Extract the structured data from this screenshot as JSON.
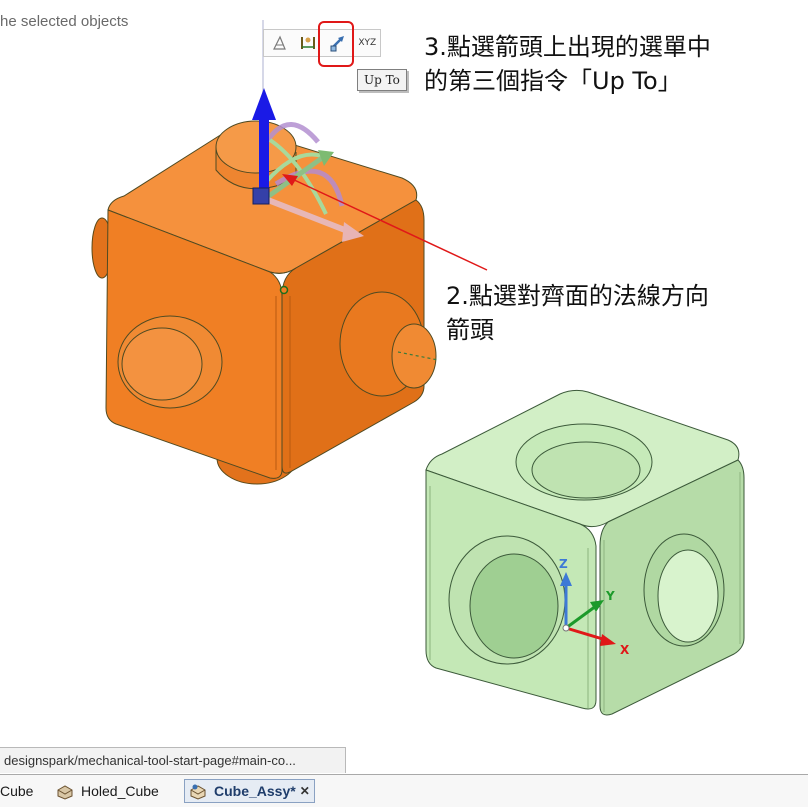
{
  "viewport": {
    "hint_text": "he selected objects"
  },
  "mini_toolbar": {
    "items": [
      {
        "name": "pull-option-icon",
        "label": ""
      },
      {
        "name": "ruler-dimension-icon",
        "label": ""
      },
      {
        "name": "up-to-icon",
        "label": ""
      },
      {
        "name": "xyz-icon",
        "label": "XYZ"
      }
    ],
    "tooltip": "Up To"
  },
  "annotations": {
    "step3": "3.點選箭頭上出現的選單中\n的第三個指令「Up To」",
    "step2": "2.點選對齊面的法線方向\n箭頭"
  },
  "axes": {
    "x": "X",
    "y": "Y",
    "z": "Z"
  },
  "colors": {
    "orange_part": "#f07f24",
    "green_part": "#c6eab9",
    "annotation_red": "#e01818",
    "arrow_blue": "#1a1ae6"
  },
  "status_bar": {
    "url": "designspark/mechanical-tool-start-page#main-co..."
  },
  "tabs": [
    {
      "label": "Cube",
      "active": false
    },
    {
      "label": "Holed_Cube",
      "active": false
    },
    {
      "label": "Cube_Assy*",
      "active": true
    }
  ]
}
